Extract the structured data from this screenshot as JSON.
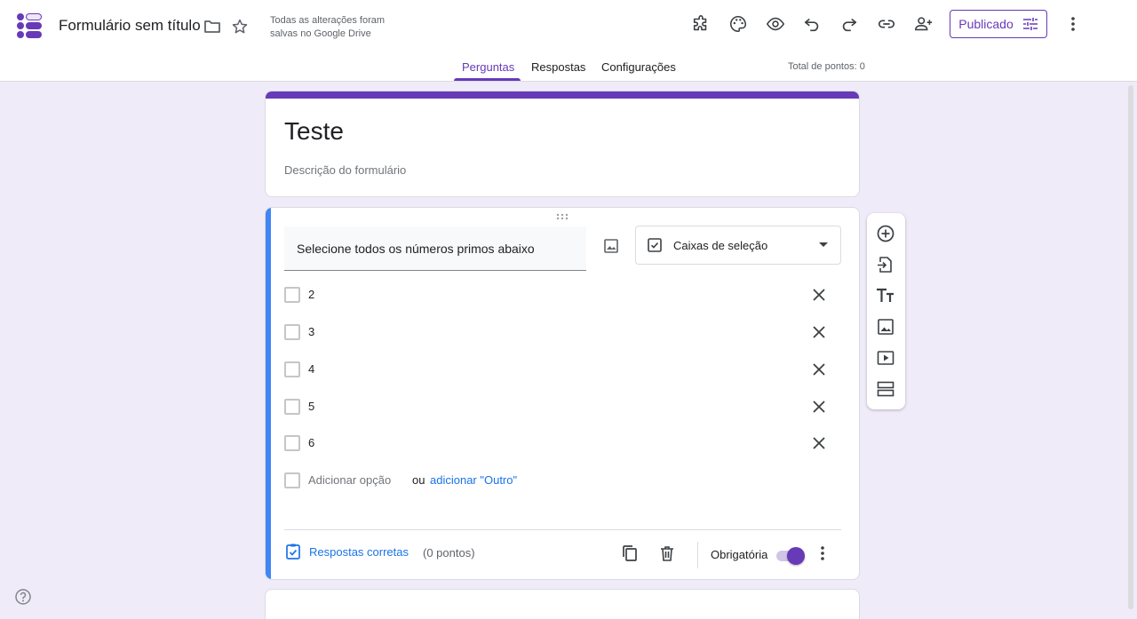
{
  "header": {
    "doc_title": "Formulário sem título",
    "save_status": "Todas as alterações foram salvas no Google Drive",
    "publish_label": "Publicado"
  },
  "tabs": [
    {
      "label": "Perguntas",
      "active": true
    },
    {
      "label": "Respostas",
      "active": false
    },
    {
      "label": "Configurações",
      "active": false
    }
  ],
  "points_total": "Total de pontos: 0",
  "form": {
    "title": "Teste",
    "description": "Descrição do formulário"
  },
  "question": {
    "text": "Selecione todos os números primos abaixo",
    "type": "Caixas de seleção",
    "options": [
      "2",
      "3",
      "4",
      "5",
      "6"
    ],
    "add_option": "Adicionar opção",
    "or": "ou",
    "add_other": "adicionar \"Outro\"",
    "answer_key": "Respostas corretas",
    "points": "(0 pontos)",
    "required_label": "Obrigatória",
    "required": true
  },
  "colors": {
    "accent": "#673ab7",
    "background": "#f0ebf8",
    "active_question": "#4285f4",
    "link": "#1a73e8"
  },
  "icons": {
    "header": [
      "forms-logo",
      "folder-icon",
      "star-icon",
      "addon-icon",
      "palette-icon",
      "preview-icon",
      "undo-icon",
      "redo-icon",
      "link-icon",
      "add-collaborator-icon",
      "tune-icon",
      "more-vert-icon"
    ],
    "toolbar": [
      "add-question-icon",
      "import-questions-icon",
      "add-title-icon",
      "add-image-icon",
      "add-video-icon",
      "add-section-icon"
    ]
  }
}
